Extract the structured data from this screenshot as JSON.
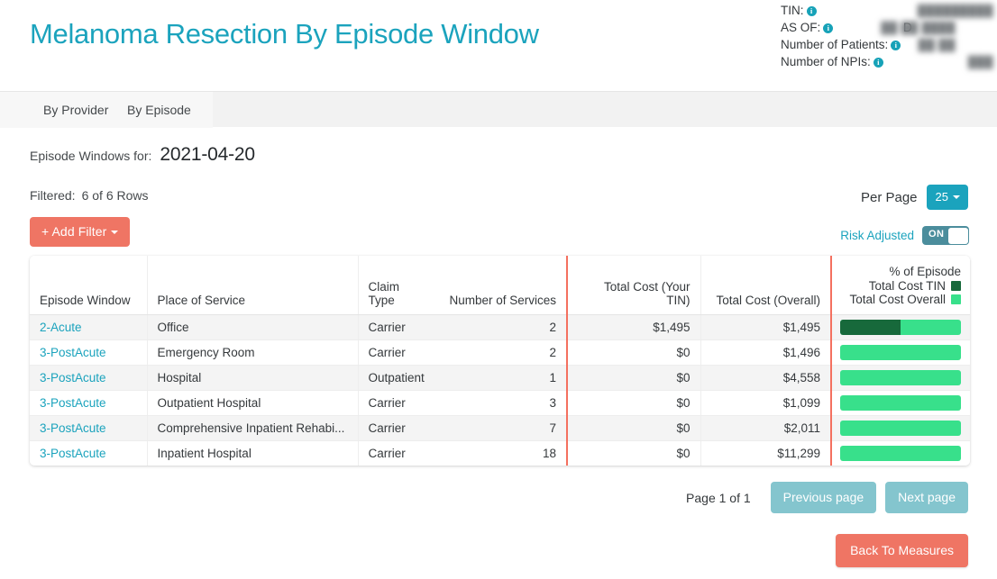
{
  "header": {
    "title": "Melanoma Resection By Episode Window",
    "meta": [
      {
        "label": "TIN:",
        "value": "█████████",
        "prefix": ""
      },
      {
        "label": "AS OF:",
        "value": "██ ██ ████",
        "prefix": "D"
      },
      {
        "label": "Number of Patients:",
        "value": "██ ██",
        "prefix": ""
      },
      {
        "label": "Number of NPIs:",
        "value": "███",
        "prefix": ""
      }
    ],
    "info_icon": "i"
  },
  "tabs": [
    {
      "label": "By Provider",
      "active": true
    },
    {
      "label": "By Episode",
      "active": false
    }
  ],
  "episode_windows": {
    "label": "Episode Windows for:",
    "value": "2021-04-20"
  },
  "filter": {
    "filtered_label": "Filtered:",
    "filtered_count": "6 of 6 Rows",
    "add_filter_label": "+ Add Filter"
  },
  "per_page": {
    "label": "Per Page",
    "value": "25"
  },
  "risk_adjusted": {
    "label": "Risk Adjusted",
    "state": "ON"
  },
  "table": {
    "columns": [
      "Episode Window",
      "Place of Service",
      "Claim Type",
      "Number of Services",
      "Total Cost (Your TIN)",
      "Total Cost (Overall)"
    ],
    "bar_column_header": {
      "line1": "% of Episode",
      "line2": "Total Cost TIN",
      "line3": "Total Cost Overall"
    },
    "rows": [
      {
        "episode_window": "2-Acute",
        "place_of_service": "Office",
        "claim_type": "Carrier",
        "number_of_services": "2",
        "total_cost_tin": "$1,495",
        "total_cost_overall": "$1,495",
        "bar_tin_pct": 50,
        "bar_overall_pct": 100
      },
      {
        "episode_window": "3-PostAcute",
        "place_of_service": "Emergency Room",
        "claim_type": "Carrier",
        "number_of_services": "2",
        "total_cost_tin": "$0",
        "total_cost_overall": "$1,496",
        "bar_tin_pct": 0,
        "bar_overall_pct": 100
      },
      {
        "episode_window": "3-PostAcute",
        "place_of_service": "Hospital",
        "claim_type": "Outpatient",
        "number_of_services": "1",
        "total_cost_tin": "$0",
        "total_cost_overall": "$4,558",
        "bar_tin_pct": 0,
        "bar_overall_pct": 100
      },
      {
        "episode_window": "3-PostAcute",
        "place_of_service": "Outpatient Hospital",
        "claim_type": "Carrier",
        "number_of_services": "3",
        "total_cost_tin": "$0",
        "total_cost_overall": "$1,099",
        "bar_tin_pct": 0,
        "bar_overall_pct": 100
      },
      {
        "episode_window": "3-PostAcute",
        "place_of_service": "Comprehensive Inpatient Rehabi...",
        "claim_type": "Carrier",
        "number_of_services": "7",
        "total_cost_tin": "$0",
        "total_cost_overall": "$2,011",
        "bar_tin_pct": 0,
        "bar_overall_pct": 100
      },
      {
        "episode_window": "3-PostAcute",
        "place_of_service": "Inpatient Hospital",
        "claim_type": "Carrier",
        "number_of_services": "18",
        "total_cost_tin": "$0",
        "total_cost_overall": "$11,299",
        "bar_tin_pct": 0,
        "bar_overall_pct": 100
      }
    ]
  },
  "pagination": {
    "page_label": "Page 1 of 1",
    "previous_label": "Previous page",
    "next_label": "Next page"
  },
  "footer": {
    "back_label": "Back To Measures"
  },
  "colors": {
    "accent_teal": "#1ba3bd",
    "accent_salmon": "#ef7564",
    "bar_tin": "#17693b",
    "bar_overall": "#38e08b",
    "pager_button": "#84c5ce",
    "toggle_on": "#4b8d9c"
  }
}
